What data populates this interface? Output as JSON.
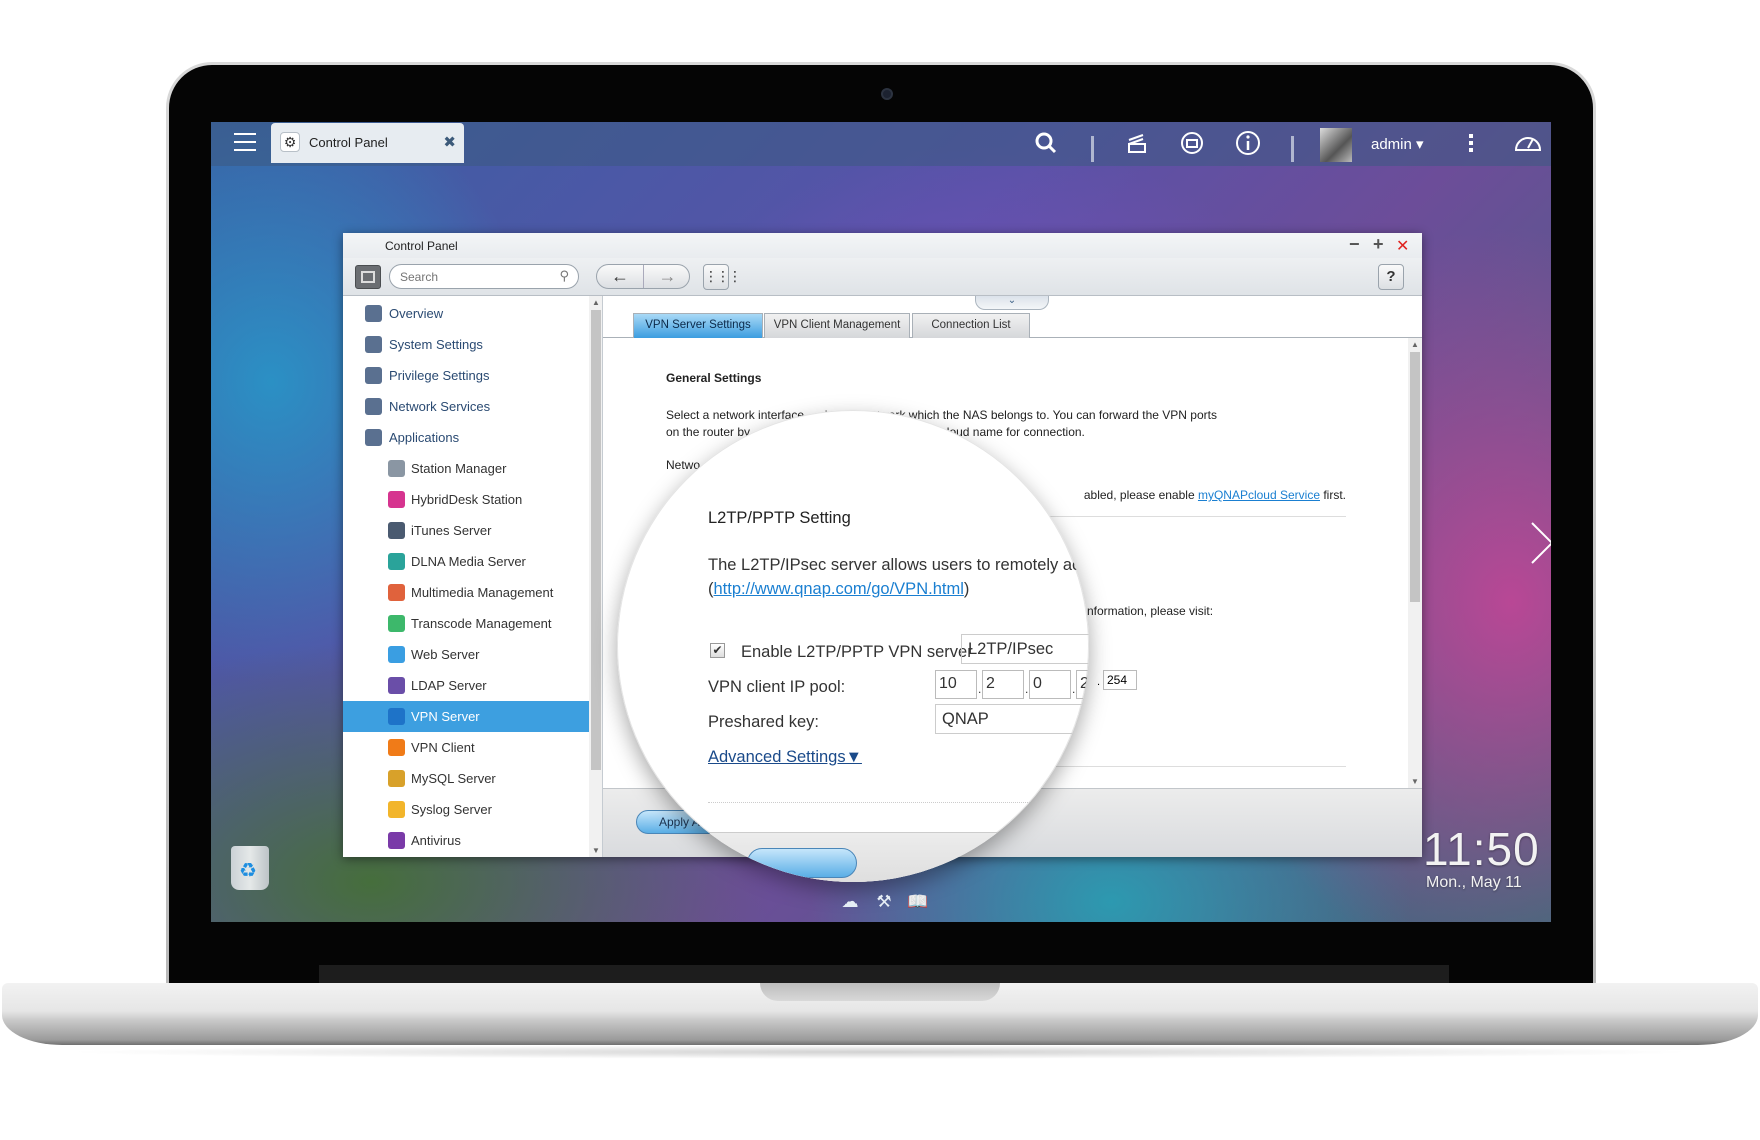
{
  "taskbar": {
    "open_tab_label": "Control Panel",
    "user_name": "admin",
    "icons": [
      "menu-icon",
      "search-icon",
      "background-tasks-icon",
      "external-device-icon",
      "info-icon",
      "more-icon",
      "dashboard-icon"
    ]
  },
  "window": {
    "title": "Control Panel",
    "search_placeholder": "Search",
    "help_label": "?",
    "minimize_label": "−",
    "maximize_label": "+",
    "close_label": "✕"
  },
  "sidebar": {
    "categories": [
      {
        "label": "Overview",
        "icon": "overview-icon"
      },
      {
        "label": "System Settings",
        "icon": "gear-icon"
      },
      {
        "label": "Privilege Settings",
        "icon": "user-icon"
      },
      {
        "label": "Network Services",
        "icon": "globe-icon"
      },
      {
        "label": "Applications",
        "icon": "inbox-icon"
      }
    ],
    "applications": [
      {
        "label": "Station Manager",
        "icon": "station-manager-icon",
        "color": "#8a96a3"
      },
      {
        "label": "HybridDesk Station",
        "icon": "hybriddesk-icon",
        "color": "#d6348f"
      },
      {
        "label": "iTunes Server",
        "icon": "itunes-icon",
        "color": "#4a5a70"
      },
      {
        "label": "DLNA Media Server",
        "icon": "dlna-icon",
        "color": "#2aa39a"
      },
      {
        "label": "Multimedia Management",
        "icon": "multimedia-icon",
        "color": "#e0623c"
      },
      {
        "label": "Transcode Management",
        "icon": "transcode-icon",
        "color": "#3db86b"
      },
      {
        "label": "Web Server",
        "icon": "web-server-icon",
        "color": "#3a9ee2"
      },
      {
        "label": "LDAP Server",
        "icon": "ldap-icon",
        "color": "#6a4ea8"
      },
      {
        "label": "VPN Server",
        "icon": "vpn-server-icon",
        "color": "#1e73c8",
        "active": true
      },
      {
        "label": "VPN Client",
        "icon": "vpn-client-icon",
        "color": "#f07b18"
      },
      {
        "label": "MySQL Server",
        "icon": "mysql-icon",
        "color": "#d8a12a"
      },
      {
        "label": "Syslog Server",
        "icon": "syslog-icon",
        "color": "#f2b52b"
      },
      {
        "label": "Antivirus",
        "icon": "antivirus-icon",
        "color": "#7a3aa8"
      }
    ],
    "active_color": "#3d9fe0"
  },
  "tabs": [
    {
      "label": "VPN Server Settings",
      "active": true
    },
    {
      "label": "VPN Client Management",
      "active": false
    },
    {
      "label": "Connection List",
      "active": false
    }
  ],
  "general": {
    "heading": "General Settings",
    "description_line1": "Select a network interface ... desired network which the NAS belongs to. You can forward the VPN ports",
    "description_line2": "on the router by ... replace the WAN IP by myQNAPcloud name for connection.",
    "network_label": "Netwo",
    "mycloud_text": "abled, please enable ",
    "mycloud_link": "myQNAPcloud Service",
    "mycloud_suffix": " first.",
    "info_text": "nformation, please visit:",
    "ip_last_end": "254"
  },
  "l2tp": {
    "title": "L2TP/PPTP Setting",
    "description": "The L2TP/IPsec server allows users to remotely acc",
    "link_prefix": "(",
    "link": "http://www.qnap.com/go/VPN.html",
    "link_suffix": ")",
    "enable_label": "Enable L2TP/PPTP VPN server",
    "enable_checked": true,
    "protocol_value": "L2TP/IPsec",
    "ip_pool_label": "VPN client IP pool:",
    "ip_pool_start": [
      "10",
      "2",
      "0",
      "2"
    ],
    "preshared_label": "Preshared key:",
    "preshared_value": "QNAP",
    "advanced_label": "Advanced Settings▼"
  },
  "footer": {
    "apply_label": "Apply A"
  },
  "desktop": {
    "clock_time": "11:50",
    "clock_date": "Mon., May 11",
    "dock_icons": [
      "mycloud-icon",
      "tools-icon",
      "book-icon"
    ]
  }
}
